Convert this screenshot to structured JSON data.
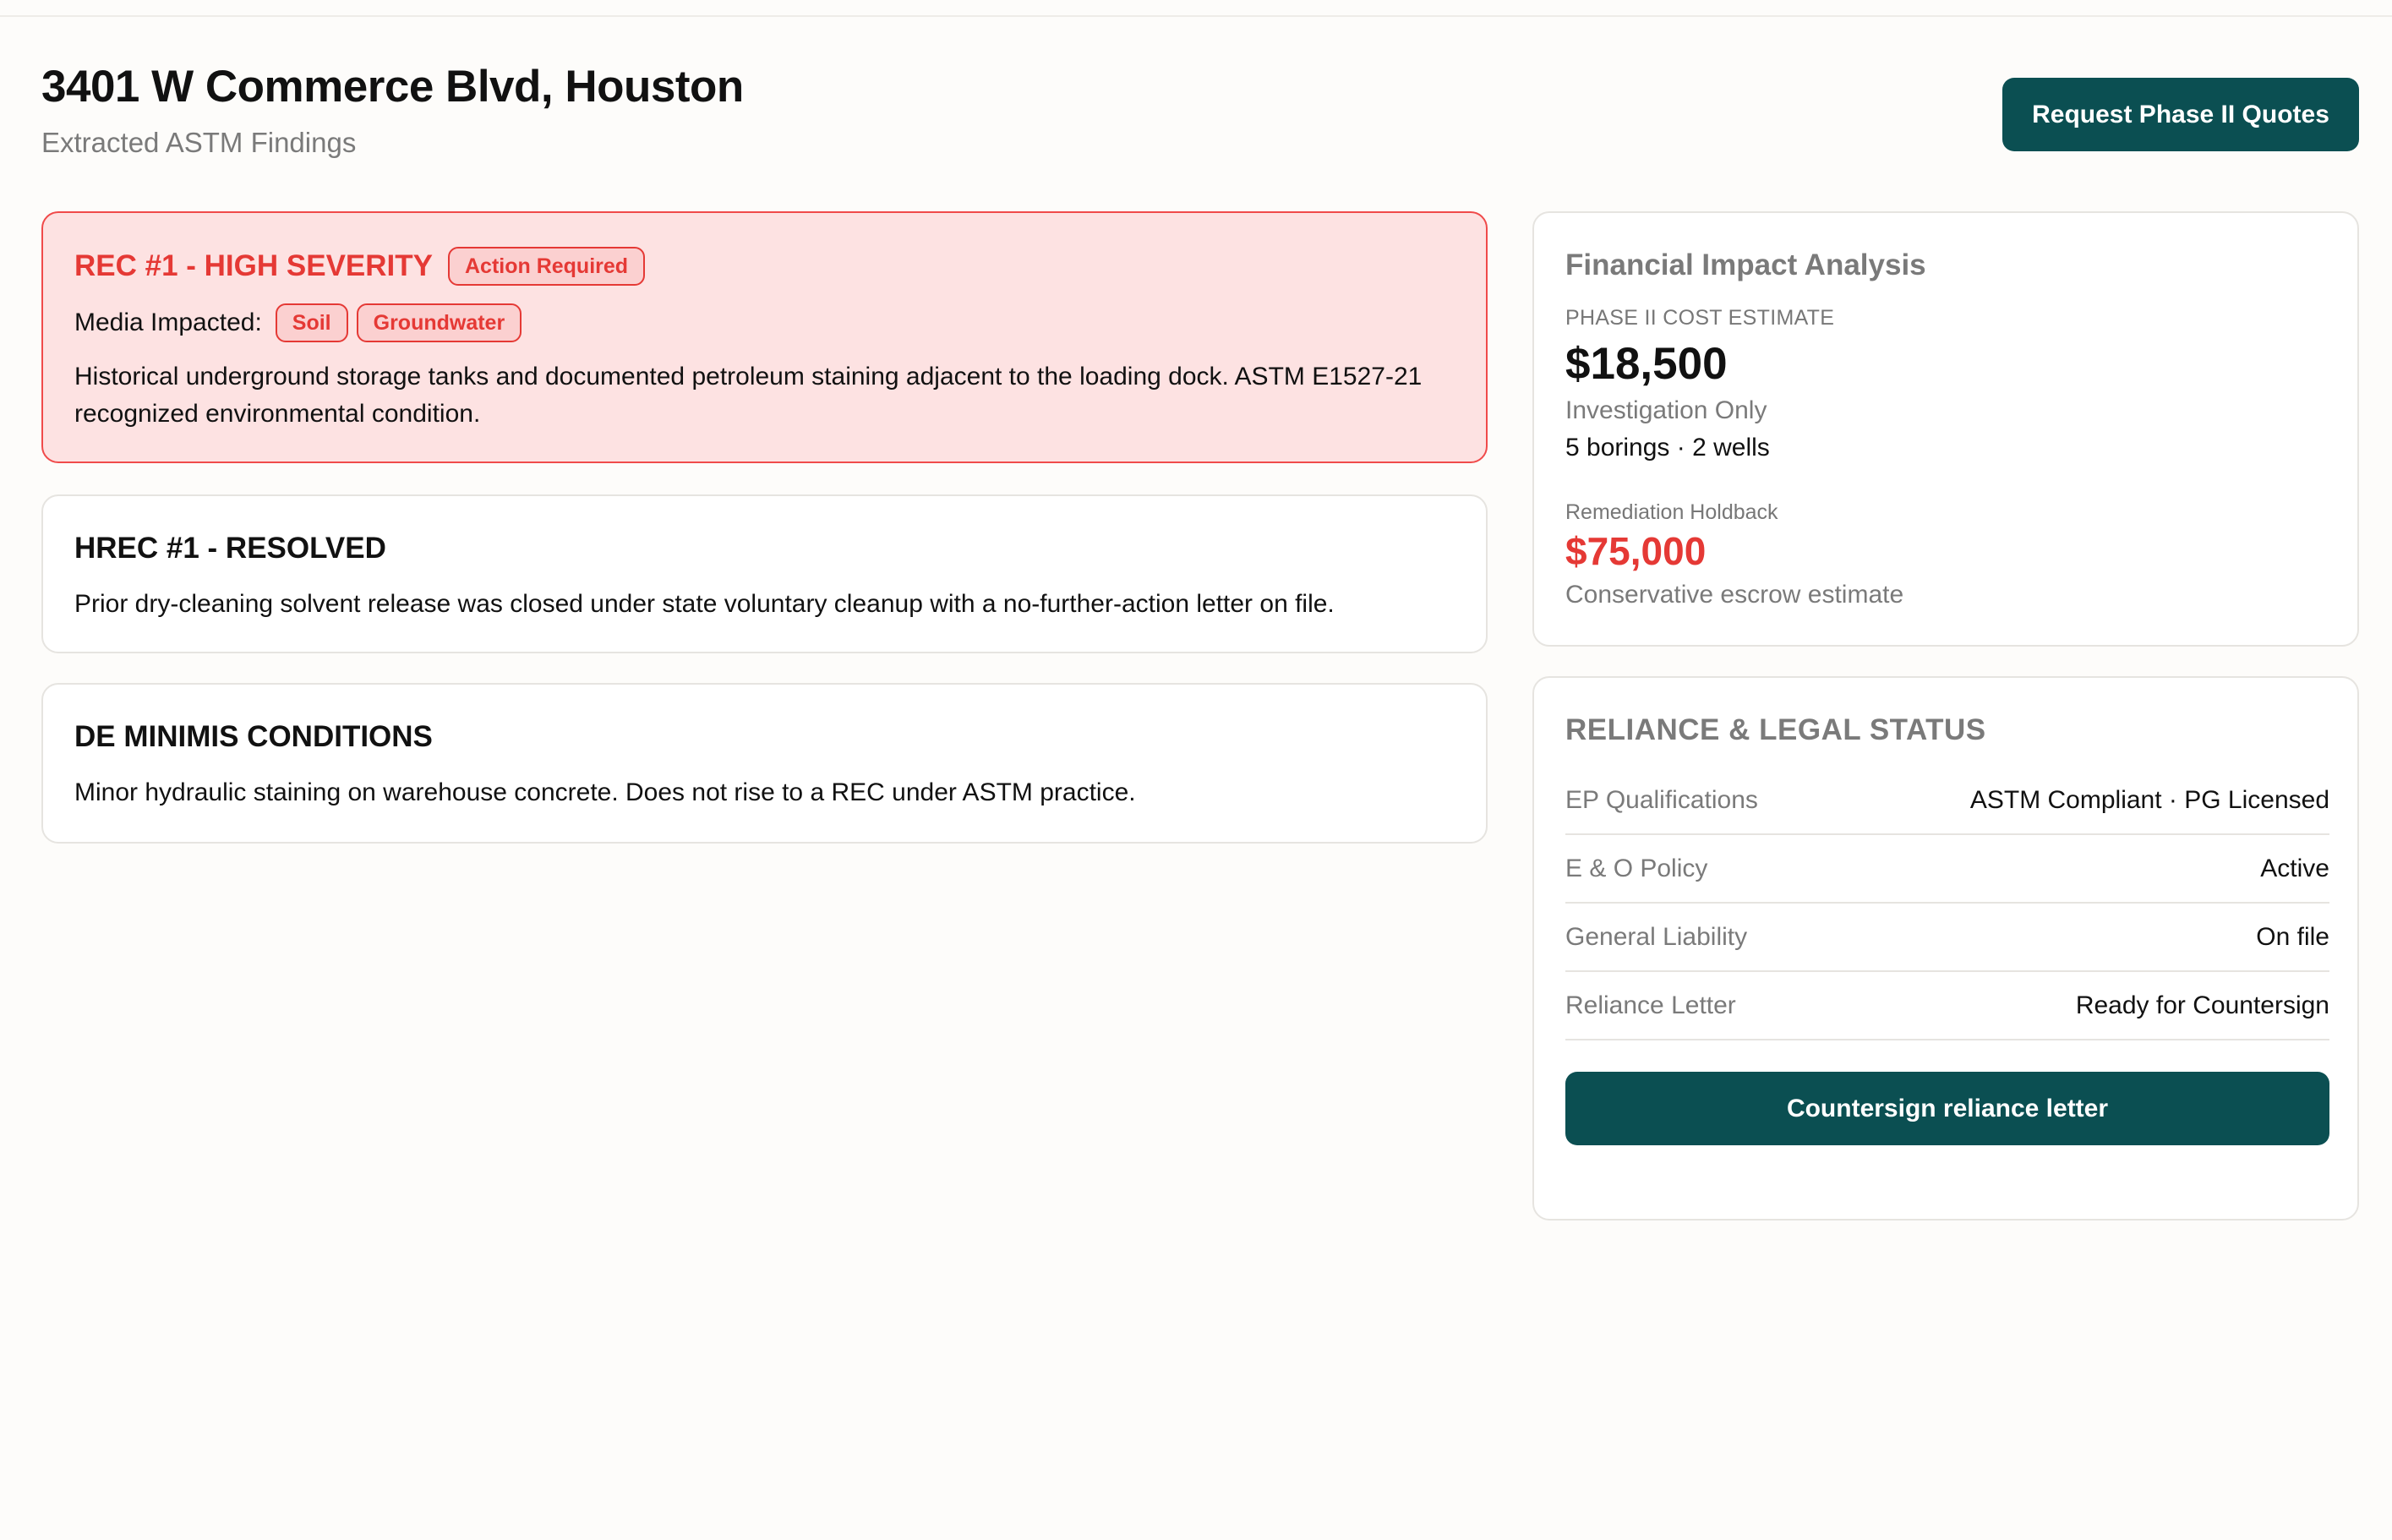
{
  "header": {
    "title": "3401 W Commerce Blvd, Houston",
    "subtitle": "Extracted ASTM Findings",
    "action_button": "Request Phase II Quotes"
  },
  "findings": {
    "rec": {
      "title": "REC #1 - HIGH SEVERITY",
      "badge": "Action Required",
      "media_label": "Media Impacted:",
      "media": [
        "Soil",
        "Groundwater"
      ],
      "description": "Historical underground storage tanks and documented petroleum staining adjacent to the loading dock. ASTM E1527-21 recognized environmental condition."
    },
    "hrec": {
      "title": "HREC #1 - RESOLVED",
      "description": "Prior dry-cleaning solvent release was closed under state voluntary cleanup with a no-further-action letter on file."
    },
    "de_minimis": {
      "title": "DE MINIMIS CONDITIONS",
      "description": "Minor hydraulic staining on warehouse concrete. Does not rise to a REC under ASTM practice."
    }
  },
  "financial": {
    "title": "Financial Impact Analysis",
    "estimate_label": "PHASE II COST ESTIMATE",
    "estimate_amount": "$18,500",
    "estimate_sub": "Investigation Only",
    "estimate_detail": "5 borings · 2 wells",
    "holdback_label": "Remediation Holdback",
    "holdback_amount": "$75,000",
    "holdback_sub": "Conservative escrow estimate"
  },
  "legal": {
    "title": "RELIANCE & LEGAL STATUS",
    "rows": [
      {
        "key": "EP Qualifications",
        "value": "ASTM Compliant · PG Licensed"
      },
      {
        "key": "E & O Policy",
        "value": "Active"
      },
      {
        "key": "General Liability",
        "value": "On file"
      },
      {
        "key": "Reliance Letter",
        "value": "Ready for Countersign"
      }
    ],
    "action_button": "Countersign reliance letter"
  },
  "colors": {
    "primary": "#0b4f52",
    "danger": "#e53935",
    "danger_bg": "#fde2e2",
    "muted": "#7a7a7a"
  }
}
